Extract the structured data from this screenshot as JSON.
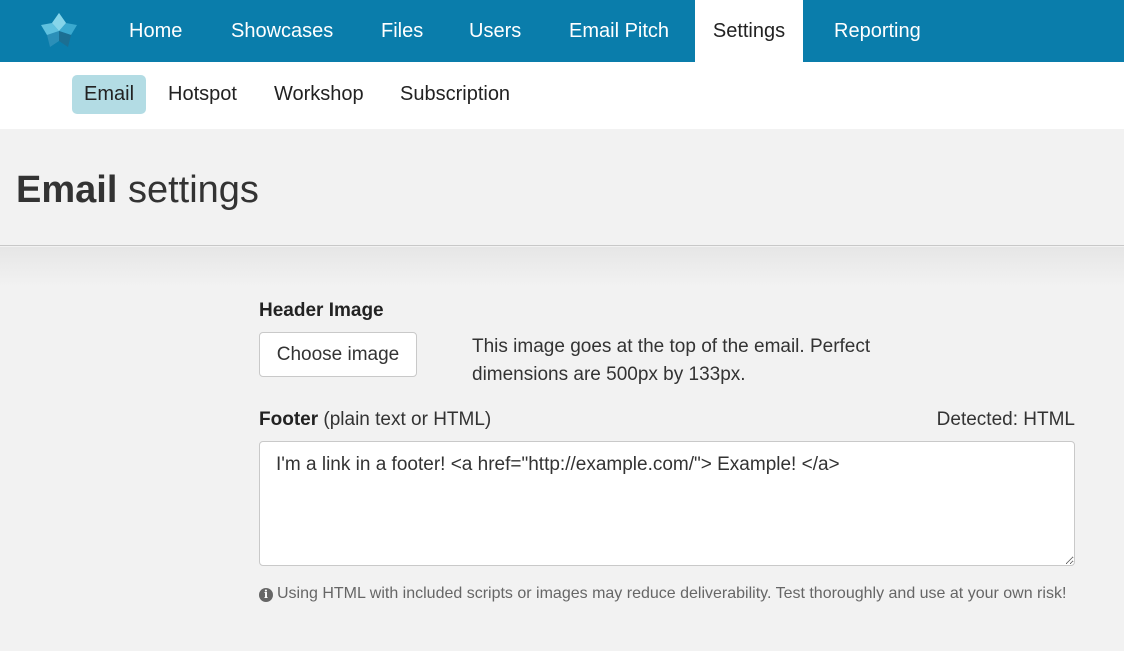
{
  "topnav": {
    "items": [
      {
        "label": "Home"
      },
      {
        "label": "Showcases"
      },
      {
        "label": "Files"
      },
      {
        "label": "Users"
      },
      {
        "label": "Email Pitch"
      },
      {
        "label": "Settings",
        "active": true
      },
      {
        "label": "Reporting"
      }
    ]
  },
  "subnav": {
    "items": [
      {
        "label": "Email",
        "active": true
      },
      {
        "label": "Hotspot"
      },
      {
        "label": "Workshop"
      },
      {
        "label": "Subscription"
      }
    ]
  },
  "page": {
    "title_bold": "Email",
    "title_rest": "settings"
  },
  "header_image": {
    "label": "Header Image",
    "button": "Choose image",
    "hint": "This image goes at the top of the email. Perfect dimensions are 500px by 133px."
  },
  "footer": {
    "label_bold": "Footer",
    "label_rest": "(plain text or HTML)",
    "detected": "Detected: HTML",
    "value": "I'm a link in a footer! <a href=\"http://example.com/\"> Example! </a>",
    "warning": "Using HTML with included scripts or images may reduce deliverability. Test thoroughly and use at your own risk!"
  },
  "icons": {
    "logo": "app-logo",
    "info": "info-icon"
  },
  "colors": {
    "nav_bg": "#0a7dab",
    "active_subnav": "#b3dce4"
  }
}
